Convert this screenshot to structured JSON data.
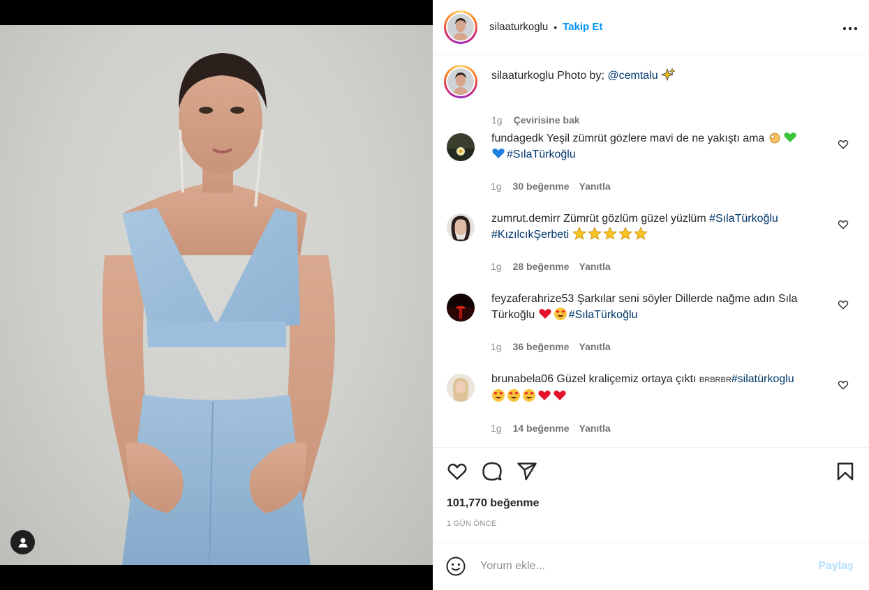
{
  "post": {
    "username": "silaaturkoglu",
    "follow_label": "Takip Et",
    "dot": "•",
    "more_label": "•••"
  },
  "caption": {
    "username": "silaaturkoglu",
    "text": "Photo by;",
    "mention": "@cemtalu",
    "time": "1g",
    "see_translation": "Çevirisine bak"
  },
  "comments": [
    {
      "username": "fundagedk",
      "text_parts": [
        "Yeşil zümrüt gözlere mavi de ne yakıştı ama "
      ],
      "hashtag": "#SılaTürkoğlu",
      "time": "1g",
      "likes": "30 beğenme",
      "reply": "Yanıtla"
    },
    {
      "username": "zumrut.demirr",
      "text_parts": [
        "Zümrüt gözlüm güzel yüzlüm "
      ],
      "hashtag": "#SılaTürkoğlu",
      "hashtag2": "#KızılcıkŞerbeti",
      "time": "1g",
      "likes": "28 beğenme",
      "reply": "Yanıtla"
    },
    {
      "username": "feyzaferahrize53",
      "text_parts": [
        "Şarkılar seni söyler Dillerde nağme adın Sıla Türkoğlu "
      ],
      "hashtag": "#SılaTürkoğlu",
      "time": "1g",
      "likes": "36 beğenme",
      "reply": "Yanıtla"
    },
    {
      "username": "brunabela06",
      "text_parts": [
        "Güzel kraliçemiz ortaya çıktı "
      ],
      "small_text": "BRBRBR",
      "hashtag": "#silatürkoglu",
      "time": "1g",
      "likes": "14 beğenme",
      "reply": "Yanıtla"
    }
  ],
  "stats": {
    "likes": "101,770 beğenme",
    "ago": "1 GÜN ÖNCE"
  },
  "composer": {
    "placeholder": "Yorum ekle...",
    "share_label": "Paylaş"
  },
  "colors": {
    "link": "#00376b",
    "follow": "#0095f6",
    "share_disabled": "#b2dffc"
  }
}
